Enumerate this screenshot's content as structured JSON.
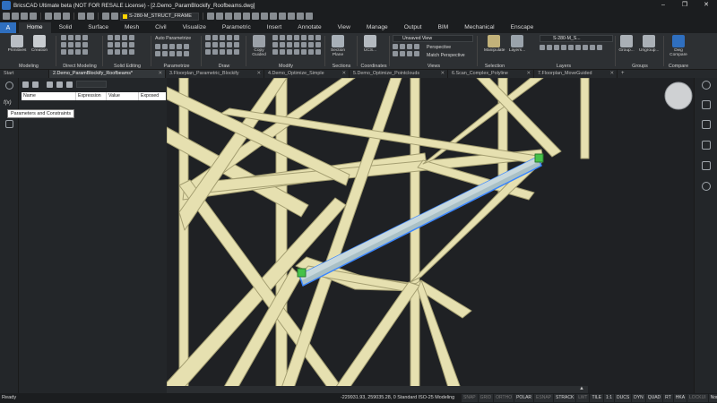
{
  "window": {
    "title": "BricsCAD Ultimate beta (NOT FOR RESALE License) - [2.Demo_ParamBlockify_Roofbeams.dwg]",
    "controls": [
      "–",
      "❐",
      "✕"
    ]
  },
  "quick_access": {
    "current_layer": "S-280-M_STRUCT_FRAME"
  },
  "ribbon_tabs": [
    "Home",
    "Solid",
    "Surface",
    "Mesh",
    "Civil",
    "Visualize",
    "Parametric",
    "Insert",
    "Annotate",
    "View",
    "Manage",
    "Output",
    "BIM",
    "Mechanical",
    "Enscape"
  ],
  "active_ribbon_tab": "Home",
  "ribbon": {
    "groups": [
      "Modeling",
      "Direct Modeling",
      "Solid Editing",
      "Parametrize",
      "Draw",
      "Modify",
      "Sections",
      "Coordinates",
      "Views",
      "Selection",
      "Layers",
      "Groups",
      "Compare"
    ],
    "primitives_label": "Primitives",
    "creation_label": "Creation",
    "auto_parametrize_label": "Auto Parametrize",
    "copy_guided_label": "Copy Guided",
    "section_plane_label": "Section Plane",
    "ucs_label": "UCS...",
    "view_combo_value": "Unsaved View",
    "perspective_label": "Perspective",
    "match_perspective_label": "Match Perspective",
    "manipulate_label": "Manipulate",
    "layers_label": "Layers...",
    "layer_combo_value": "S-280-M_S...",
    "group_label": "Group...",
    "ungroup_label": "Ungroup...",
    "dwg_compare_label": "Dwg Compare"
  },
  "doc_tabs": [
    {
      "label": "Start",
      "active": false,
      "closable": false
    },
    {
      "label": "2.Demo_ParamBlockify_Roofbeams*",
      "active": true,
      "closable": true
    },
    {
      "label": "3.Floorplan_Parametric_Blockify",
      "active": false,
      "closable": true
    },
    {
      "label": "4.Demo_Optimize_Simple",
      "active": false,
      "closable": true
    },
    {
      "label": "5.Demo_Optimize_Pointclouds",
      "active": false,
      "closable": true
    },
    {
      "label": "6.Scan_Complex_Polyline",
      "active": false,
      "closable": true
    },
    {
      "label": "7.Floorplan_MoveGuided",
      "active": false,
      "closable": true
    }
  ],
  "parameters_panel": {
    "columns": [
      "Name",
      "Expression",
      "Value",
      "Exposed"
    ],
    "search_placeholder": "",
    "tooltip": "Parameters and Constraints",
    "tab_glyph": "f(x)"
  },
  "status_bar": {
    "ready": "Ready",
    "coordinates": "-229931.93, 259035.28, 0",
    "standard": "Standard",
    "dimstyle": "ISO-25",
    "workspace": "Modeling",
    "toggles": [
      "SNAP",
      "GRID",
      "ORTHO",
      "POLAR",
      "ESNAP",
      "STRACK",
      "LWT",
      "TILE",
      "1:1",
      "DUCS",
      "DYN",
      "QUAD",
      "RT",
      "HKA",
      "LOCKUI",
      "None"
    ],
    "toggles_off": [
      "SNAP",
      "GRID",
      "ORTHO",
      "ESNAP",
      "LWT",
      "LOCKUI"
    ]
  },
  "colors": {
    "beam": "#e6e0b0",
    "beam_edge": "#a59f72",
    "selected_beam": "#a9c0c6",
    "selection_outline": "#3a86ff",
    "grip": "#45c24a",
    "background": "#1f2124"
  }
}
